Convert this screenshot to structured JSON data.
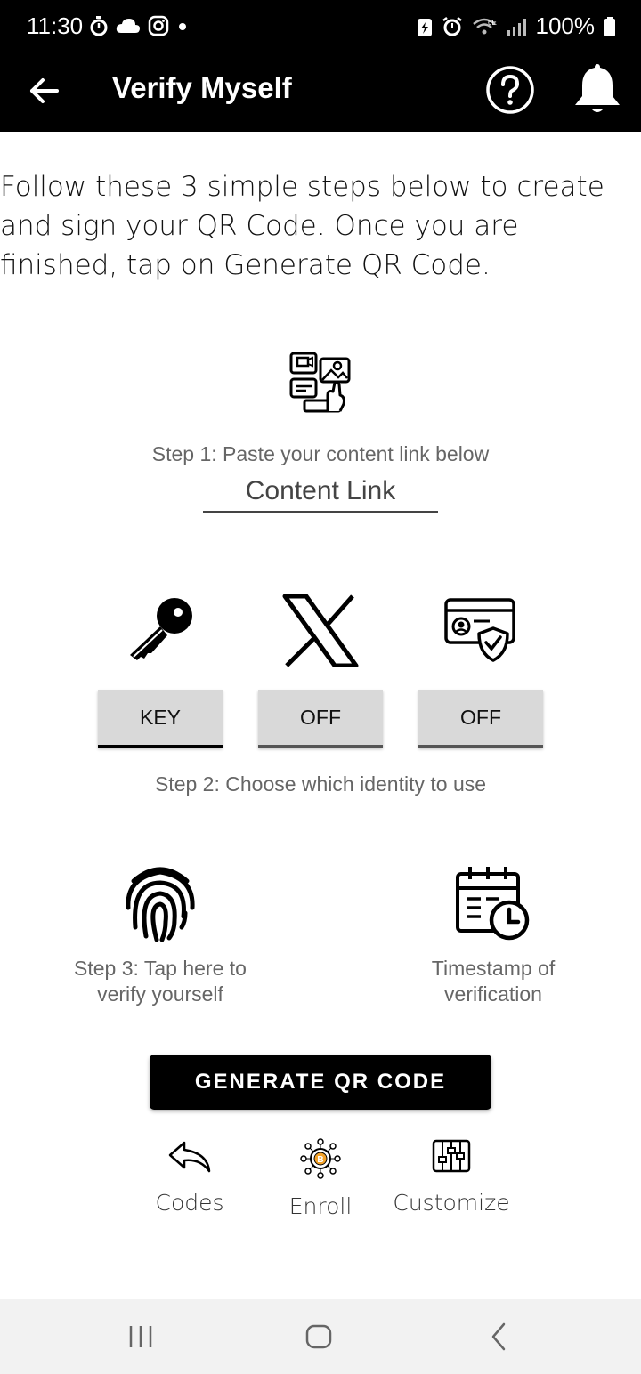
{
  "status": {
    "time": "11:30",
    "battery": "100%"
  },
  "appbar": {
    "title": "Verify Myself"
  },
  "intro": "Follow these 3 simple steps below to create and sign your QR Code. Once you are finished, tap on Generate QR Code.",
  "step1": {
    "text": "Step 1: Paste your content link below",
    "placeholder": "Content Link"
  },
  "identity": {
    "buttons": [
      {
        "label": "KEY",
        "icon": "key-icon"
      },
      {
        "label": "OFF",
        "icon": "x-logo-icon"
      },
      {
        "label": "OFF",
        "icon": "id-card-shield-icon"
      }
    ],
    "step2_text": "Step 2: Choose which identity to use"
  },
  "step3": {
    "text": "Step 3: Tap here to verify yourself",
    "icon": "fingerprint-icon"
  },
  "timestamp": {
    "text": "Timestamp of verification",
    "icon": "calendar-clock-icon"
  },
  "generate_label": "GENERATE QR CODE",
  "bottom_actions": [
    {
      "label": "Codes",
      "icon": "reply-arrow-icon"
    },
    {
      "label": "Enroll",
      "icon": "bitcoin-network-icon"
    },
    {
      "label": "Customize",
      "icon": "sliders-icon"
    }
  ],
  "colors": {
    "bar": "#000000",
    "button_gray": "#d9d9d9",
    "nav_bg": "#f2f2f2"
  }
}
